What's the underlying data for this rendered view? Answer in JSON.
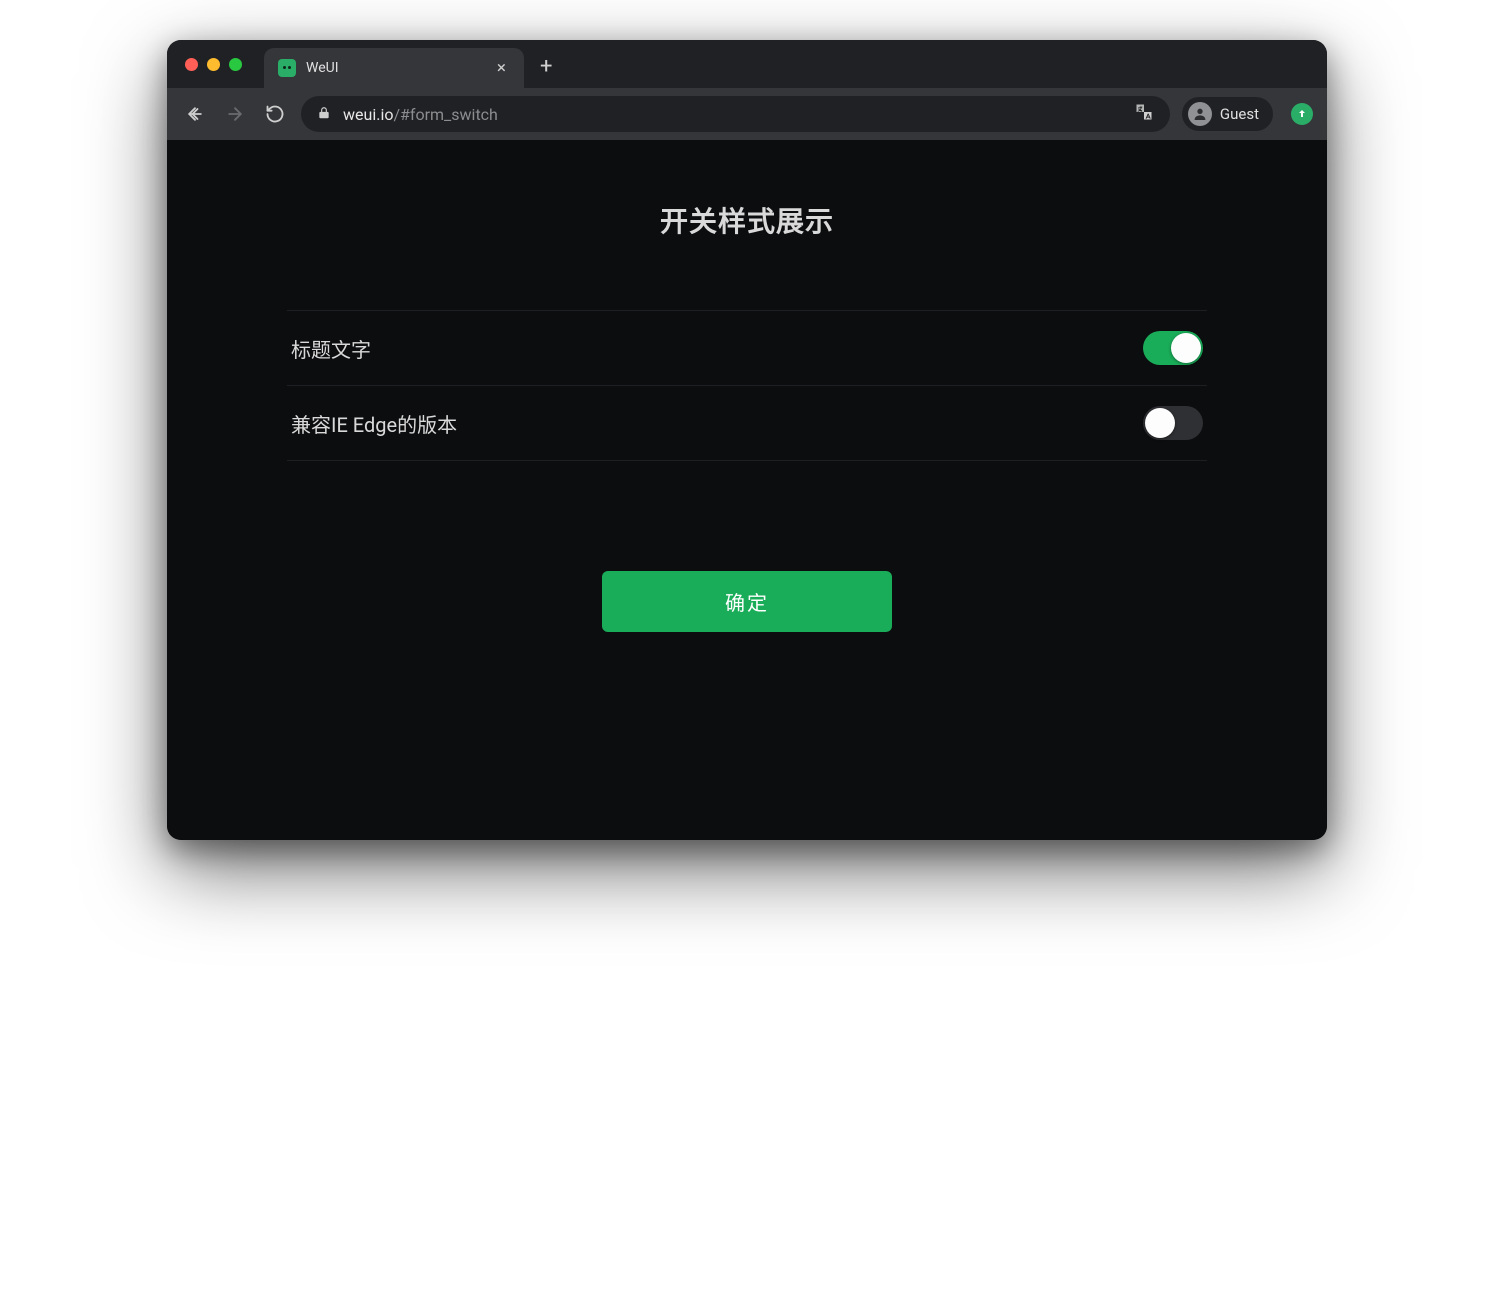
{
  "browser": {
    "tab_title": "WeUI",
    "url_host": "weui.io",
    "url_path": "/#form_switch",
    "profile_label": "Guest"
  },
  "page": {
    "title": "开关样式展示",
    "switches": [
      {
        "label": "标题文字",
        "checked": true
      },
      {
        "label": "兼容IE Edge的版本",
        "checked": false
      }
    ],
    "submit_label": "确定"
  },
  "colors": {
    "accent": "#1aad59"
  }
}
